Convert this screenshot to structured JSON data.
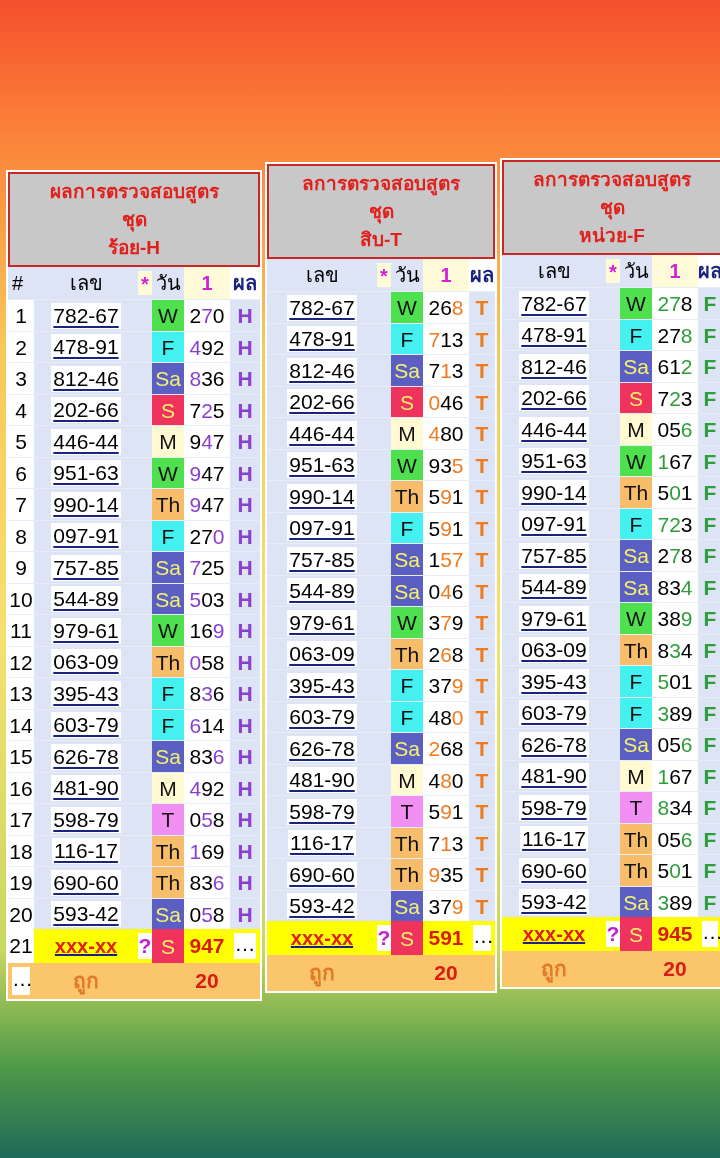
{
  "tables": [
    {
      "title_lines": [
        "ผลการตรวจสอบสูตร",
        "ชุด",
        "ร้อย-H"
      ],
      "color": "#8a3fd1",
      "columns": [
        "#",
        "เลข",
        "*",
        "วัน",
        "1",
        "ผล"
      ],
      "rows": [
        {
          "index": "1",
          "number": "782-67",
          "day": {
            "label": "W",
            "color": "#4fe04f"
          },
          "draw": {
            "before": "2",
            "hit": "7",
            "after": "0"
          },
          "result": "H"
        },
        {
          "index": "2",
          "number": "478-91",
          "day": {
            "label": "F",
            "color": "#45f0f0"
          },
          "draw": {
            "hit": "4",
            "after": "92"
          },
          "result": "H"
        },
        {
          "index": "3",
          "number": "812-46",
          "day": {
            "label": "Sa",
            "color": "#5b5fc4"
          },
          "draw": {
            "hit": "8",
            "after": "36"
          },
          "result": "H"
        },
        {
          "index": "4",
          "number": "202-66",
          "day": {
            "label": "S",
            "color": "#f0335c"
          },
          "draw": {
            "before": "7",
            "hit": "2",
            "after": "5"
          },
          "result": "H"
        },
        {
          "index": "5",
          "number": "446-44",
          "day": {
            "label": "M",
            "color": "#fffad2"
          },
          "draw": {
            "before": "9",
            "hit": "4",
            "after": "7"
          },
          "result": "H"
        },
        {
          "index": "6",
          "number": "951-63",
          "day": {
            "label": "W",
            "color": "#4fe04f"
          },
          "draw": {
            "hit": "9",
            "after": "47"
          },
          "result": "H"
        },
        {
          "index": "7",
          "number": "990-14",
          "day": {
            "label": "Th",
            "color": "#f7bd6a"
          },
          "draw": {
            "hit": "9",
            "after": "47"
          },
          "result": "H"
        },
        {
          "index": "8",
          "number": "097-91",
          "day": {
            "label": "F",
            "color": "#45f0f0"
          },
          "draw": {
            "before": "27",
            "hit": "0"
          },
          "result": "H"
        },
        {
          "index": "9",
          "number": "757-85",
          "day": {
            "label": "Sa",
            "color": "#5b5fc4"
          },
          "draw": {
            "hit": "7",
            "after": "25"
          },
          "result": "H"
        },
        {
          "index": "10",
          "number": "544-89",
          "day": {
            "label": "Sa",
            "color": "#5b5fc4"
          },
          "draw": {
            "hit": "5",
            "after": "03"
          },
          "result": "H"
        },
        {
          "index": "11",
          "number": "979-61",
          "day": {
            "label": "W",
            "color": "#4fe04f"
          },
          "draw": {
            "before": "16",
            "hit": "9"
          },
          "result": "H"
        },
        {
          "index": "12",
          "number": "063-09",
          "day": {
            "label": "Th",
            "color": "#f7bd6a"
          },
          "draw": {
            "hit": "0",
            "after": "58"
          },
          "result": "H"
        },
        {
          "index": "13",
          "number": "395-43",
          "day": {
            "label": "F",
            "color": "#45f0f0"
          },
          "draw": {
            "before": "8",
            "hit": "3",
            "after": "6"
          },
          "result": "H"
        },
        {
          "index": "14",
          "number": "603-79",
          "day": {
            "label": "F",
            "color": "#45f0f0"
          },
          "draw": {
            "hit": "6",
            "after": "14"
          },
          "result": "H"
        },
        {
          "index": "15",
          "number": "626-78",
          "day": {
            "label": "Sa",
            "color": "#5b5fc4"
          },
          "draw": {
            "before": "83",
            "hit": "6"
          },
          "result": "H"
        },
        {
          "index": "16",
          "number": "481-90",
          "day": {
            "label": "M",
            "color": "#fffad2"
          },
          "draw": {
            "hit": "4",
            "after": "92"
          },
          "result": "H"
        },
        {
          "index": "17",
          "number": "598-79",
          "day": {
            "label": "T",
            "color": "#f28ff2"
          },
          "draw": {
            "before": "0",
            "hit": "5",
            "after": "8"
          },
          "result": "H"
        },
        {
          "index": "18",
          "number": "116-17",
          "day": {
            "label": "Th",
            "color": "#f7bd6a"
          },
          "draw": {
            "hit": "1",
            "after": "69"
          },
          "result": "H"
        },
        {
          "index": "19",
          "number": "690-60",
          "day": {
            "label": "Th",
            "color": "#f7bd6a"
          },
          "draw": {
            "before": "83",
            "hit": "6"
          },
          "result": "H"
        },
        {
          "index": "20",
          "number": "593-42",
          "day": {
            "label": "Sa",
            "color": "#5b5fc4"
          },
          "draw": {
            "before": "0",
            "hit": "5",
            "after": "8"
          },
          "result": "H"
        }
      ],
      "pending": {
        "index": "21",
        "number": "xxx-xx",
        "mark": "?",
        "day": {
          "label": "S",
          "color": "#f0335c"
        },
        "draw": "947",
        "result": "…"
      },
      "footer": {
        "index": "…",
        "label": "ถูก",
        "count": "20"
      }
    },
    {
      "title_lines": [
        "ลการตรวจสอบสูตร",
        "ชุด",
        "สิบ-T"
      ],
      "color": "#f07a1e",
      "columns": [
        "เลข",
        "*",
        "วัน",
        "1",
        "ผล"
      ],
      "rows": [
        {
          "number": "782-67",
          "day": {
            "label": "W",
            "color": "#4fe04f"
          },
          "draw": {
            "before": "26",
            "hit": "8"
          },
          "result": "T"
        },
        {
          "number": "478-91",
          "day": {
            "label": "F",
            "color": "#45f0f0"
          },
          "draw": {
            "hit": "7",
            "after": "13"
          },
          "result": "T"
        },
        {
          "number": "812-46",
          "day": {
            "label": "Sa",
            "color": "#5b5fc4"
          },
          "draw": {
            "before": "7",
            "hit": "1",
            "after": "3"
          },
          "result": "T"
        },
        {
          "number": "202-66",
          "day": {
            "label": "S",
            "color": "#f0335c"
          },
          "draw": {
            "hit": "0",
            "after": "46"
          },
          "result": "T"
        },
        {
          "number": "446-44",
          "day": {
            "label": "M",
            "color": "#fffad2"
          },
          "draw": {
            "hit": "4",
            "after": "80"
          },
          "result": "T"
        },
        {
          "number": "951-63",
          "day": {
            "label": "W",
            "color": "#4fe04f"
          },
          "draw": {
            "before": "93",
            "hit": "5"
          },
          "result": "T"
        },
        {
          "number": "990-14",
          "day": {
            "label": "Th",
            "color": "#f7bd6a"
          },
          "draw": {
            "before": "5",
            "hit": "9",
            "after": "1"
          },
          "result": "T"
        },
        {
          "number": "097-91",
          "day": {
            "label": "F",
            "color": "#45f0f0"
          },
          "draw": {
            "before": "5",
            "hit": "9",
            "after": "1"
          },
          "result": "T"
        },
        {
          "number": "757-85",
          "day": {
            "label": "Sa",
            "color": "#5b5fc4"
          },
          "draw": {
            "before": "1",
            "hit": "57"
          },
          "result": "T"
        },
        {
          "number": "544-89",
          "day": {
            "label": "Sa",
            "color": "#5b5fc4"
          },
          "draw": {
            "before": "0",
            "hit": "4",
            "after": "6"
          },
          "result": "T"
        },
        {
          "number": "979-61",
          "day": {
            "label": "W",
            "color": "#4fe04f"
          },
          "draw": {
            "before": "3",
            "hit": "7",
            "after": "9"
          },
          "result": "T"
        },
        {
          "number": "063-09",
          "day": {
            "label": "Th",
            "color": "#f7bd6a"
          },
          "draw": {
            "before": "2",
            "hit": "6",
            "after": "8"
          },
          "result": "T"
        },
        {
          "number": "395-43",
          "day": {
            "label": "F",
            "color": "#45f0f0"
          },
          "draw": {
            "before": "37",
            "hit": "9"
          },
          "result": "T"
        },
        {
          "number": "603-79",
          "day": {
            "label": "F",
            "color": "#45f0f0"
          },
          "draw": {
            "before": "48",
            "hit": "0"
          },
          "result": "T"
        },
        {
          "number": "626-78",
          "day": {
            "label": "Sa",
            "color": "#5b5fc4"
          },
          "draw": {
            "hit": "2",
            "after": "68"
          },
          "result": "T"
        },
        {
          "number": "481-90",
          "day": {
            "label": "M",
            "color": "#fffad2"
          },
          "draw": {
            "before": "4",
            "hit": "8",
            "after": "0"
          },
          "result": "T"
        },
        {
          "number": "598-79",
          "day": {
            "label": "T",
            "color": "#f28ff2"
          },
          "draw": {
            "before": "5",
            "hit": "9",
            "after": "1"
          },
          "result": "T"
        },
        {
          "number": "116-17",
          "day": {
            "label": "Th",
            "color": "#f7bd6a"
          },
          "draw": {
            "before": "7",
            "hit": "1",
            "after": "3"
          },
          "result": "T"
        },
        {
          "number": "690-60",
          "day": {
            "label": "Th",
            "color": "#f7bd6a"
          },
          "draw": {
            "hit": "9",
            "after": "35"
          },
          "result": "T"
        },
        {
          "number": "593-42",
          "day": {
            "label": "Sa",
            "color": "#5b5fc4"
          },
          "draw": {
            "before": "37",
            "hit": "9"
          },
          "result": "T"
        }
      ],
      "pending": {
        "number": "xxx-xx",
        "mark": "?",
        "day": {
          "label": "S",
          "color": "#f0335c"
        },
        "draw": "591",
        "result": "…"
      },
      "footer": {
        "label": "ถูก",
        "count": "20"
      }
    },
    {
      "title_lines": [
        "ลการตรวจสอบสูตร",
        "ชุด",
        "หน่วย-F"
      ],
      "color": "#2e9e3a",
      "columns": [
        "เลข",
        "*",
        "วัน",
        "1",
        "ผล"
      ],
      "rows": [
        {
          "number": "782-67",
          "day": {
            "label": "W",
            "color": "#4fe04f"
          },
          "draw": {
            "hit": "27",
            "after": "8"
          },
          "result": "F"
        },
        {
          "number": "478-91",
          "day": {
            "label": "F",
            "color": "#45f0f0"
          },
          "draw": {
            "before": "27",
            "hit": "8"
          },
          "result": "F"
        },
        {
          "number": "812-46",
          "day": {
            "label": "Sa",
            "color": "#5b5fc4"
          },
          "draw": {
            "before": "61",
            "hit": "2"
          },
          "result": "F"
        },
        {
          "number": "202-66",
          "day": {
            "label": "S",
            "color": "#f0335c"
          },
          "draw": {
            "before": "7",
            "hit": "2",
            "after": "3"
          },
          "result": "F"
        },
        {
          "number": "446-44",
          "day": {
            "label": "M",
            "color": "#fffad2"
          },
          "draw": {
            "before": "05",
            "hit": "6"
          },
          "result": "F"
        },
        {
          "number": "951-63",
          "day": {
            "label": "W",
            "color": "#4fe04f"
          },
          "draw": {
            "hit": "1",
            "after": "67"
          },
          "result": "F"
        },
        {
          "number": "990-14",
          "day": {
            "label": "Th",
            "color": "#f7bd6a"
          },
          "draw": {
            "before": "5",
            "hit": "0",
            "after": "1"
          },
          "result": "F"
        },
        {
          "number": "097-91",
          "day": {
            "label": "F",
            "color": "#45f0f0"
          },
          "draw": {
            "hit": "72",
            "after": "3"
          },
          "result": "F"
        },
        {
          "number": "757-85",
          "day": {
            "label": "Sa",
            "color": "#5b5fc4"
          },
          "draw": {
            "before": "2",
            "hit": "7",
            "after": "8"
          },
          "result": "F"
        },
        {
          "number": "544-89",
          "day": {
            "label": "Sa",
            "color": "#5b5fc4"
          },
          "draw": {
            "before": "83",
            "hit": "4"
          },
          "result": "F"
        },
        {
          "number": "979-61",
          "day": {
            "label": "W",
            "color": "#4fe04f"
          },
          "draw": {
            "before": "38",
            "hit": "9"
          },
          "result": "F"
        },
        {
          "number": "063-09",
          "day": {
            "label": "Th",
            "color": "#f7bd6a"
          },
          "draw": {
            "before": "8",
            "hit": "3",
            "after": "4"
          },
          "result": "F"
        },
        {
          "number": "395-43",
          "day": {
            "label": "F",
            "color": "#45f0f0"
          },
          "draw": {
            "hit": "5",
            "after": "01"
          },
          "result": "F"
        },
        {
          "number": "603-79",
          "day": {
            "label": "F",
            "color": "#45f0f0"
          },
          "draw": {
            "hit": "3",
            "after": "89"
          },
          "result": "F"
        },
        {
          "number": "626-78",
          "day": {
            "label": "Sa",
            "color": "#5b5fc4"
          },
          "draw": {
            "before": "05",
            "hit": "6"
          },
          "result": "F"
        },
        {
          "number": "481-90",
          "day": {
            "label": "M",
            "color": "#fffad2"
          },
          "draw": {
            "hit": "1",
            "after": "67"
          },
          "result": "F"
        },
        {
          "number": "598-79",
          "day": {
            "label": "T",
            "color": "#f28ff2"
          },
          "draw": {
            "hit": "8",
            "after": "34"
          },
          "result": "F"
        },
        {
          "number": "116-17",
          "day": {
            "label": "Th",
            "color": "#f7bd6a"
          },
          "draw": {
            "before": "05",
            "hit": "6"
          },
          "result": "F"
        },
        {
          "number": "690-60",
          "day": {
            "label": "Th",
            "color": "#f7bd6a"
          },
          "draw": {
            "before": "5",
            "hit": "0",
            "after": "1"
          },
          "result": "F"
        },
        {
          "number": "593-42",
          "day": {
            "label": "Sa",
            "color": "#5b5fc4"
          },
          "draw": {
            "hit": "3",
            "after": "89"
          },
          "result": "F"
        }
      ],
      "pending": {
        "number": "xxx-xx",
        "mark": "?",
        "day": {
          "label": "S",
          "color": "#f0335c"
        },
        "draw": "945",
        "result": "…"
      },
      "footer": {
        "label": "ถูก",
        "count": "20"
      }
    }
  ]
}
